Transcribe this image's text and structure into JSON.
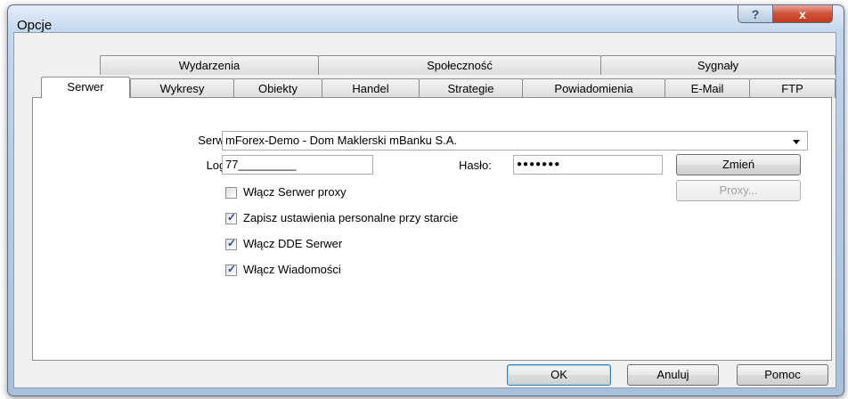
{
  "window": {
    "title": "Opcje",
    "help_glyph": "?",
    "close_glyph": "x"
  },
  "tabs_row1": [
    {
      "label": "Wydarzenia"
    },
    {
      "label": "Społeczność"
    },
    {
      "label": "Sygnały"
    }
  ],
  "tabs_row2": [
    {
      "label": "Serwer",
      "selected": true
    },
    {
      "label": "Wykresy"
    },
    {
      "label": "Obiekty"
    },
    {
      "label": "Handel"
    },
    {
      "label": "Strategie"
    },
    {
      "label": "Powiadomienia"
    },
    {
      "label": "E-Mail"
    },
    {
      "label": "FTP"
    }
  ],
  "server": {
    "label": "Serwer:",
    "value": "mForex-Demo - Dom Maklerski mBanku S.A.",
    "login_label": "Login:",
    "login_value": "77_________",
    "password_label": "Hasło:",
    "password_value": "●●●●●●●",
    "change_button": "Zmień",
    "proxy_button": "Proxy..."
  },
  "checkboxes": [
    {
      "label": "Włącz Serwer proxy",
      "checked": false
    },
    {
      "label": "Zapisz ustawienia personalne przy starcie",
      "checked": true
    },
    {
      "label": "Włącz DDE Serwer",
      "checked": true
    },
    {
      "label": "Włącz Wiadomości",
      "checked": true
    }
  ],
  "footer": {
    "ok": "OK",
    "cancel": "Anuluj",
    "help": "Pomoc"
  },
  "check_glyph": "✓"
}
